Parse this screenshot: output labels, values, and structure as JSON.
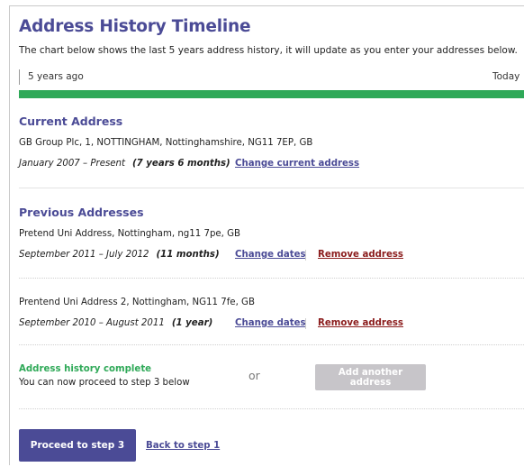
{
  "timeline": {
    "title": "Address History Timeline",
    "intro": "The chart below shows the last 5 years address history, it will update as you enter your addresses below.",
    "start_label": "5 years ago",
    "end_label": "Today",
    "bar_color": "#2fa958",
    "coverage_percent": 100
  },
  "current": {
    "heading": "Current Address",
    "address": "GB Group Plc, 1, NOTTINGHAM, Nottinghamshire, NG11 7EP, GB",
    "dates": "January 2007 – Present",
    "duration": "(7 years 6 months)",
    "change_link": "Change current address"
  },
  "previous": {
    "heading": "Previous Addresses",
    "items": [
      {
        "address": "Pretend Uni Address, Nottingham, ng11 7pe, GB",
        "dates": "September 2011 – July 2012",
        "duration": "(11 months)",
        "change_link": "Change dates",
        "remove_link": "Remove address"
      },
      {
        "address": "Prentend Uni Address 2, Nottingham, NG11 7fe, GB",
        "dates": "September 2010 – August 2011",
        "duration": "(1 year)",
        "change_link": "Change dates",
        "remove_link": "Remove address"
      }
    ]
  },
  "status": {
    "complete": "Address history complete",
    "proceed_note": "You can now proceed to step 3 below",
    "or": "or",
    "add_button": "Add another address"
  },
  "footer": {
    "proceed_button": "Proceed to step 3",
    "back_link": "Back to step 1"
  },
  "colors": {
    "heading": "#4b4b96",
    "link_remove": "#8b1c1c",
    "success": "#2fa958",
    "disabled_button": "#c7c5c9"
  }
}
